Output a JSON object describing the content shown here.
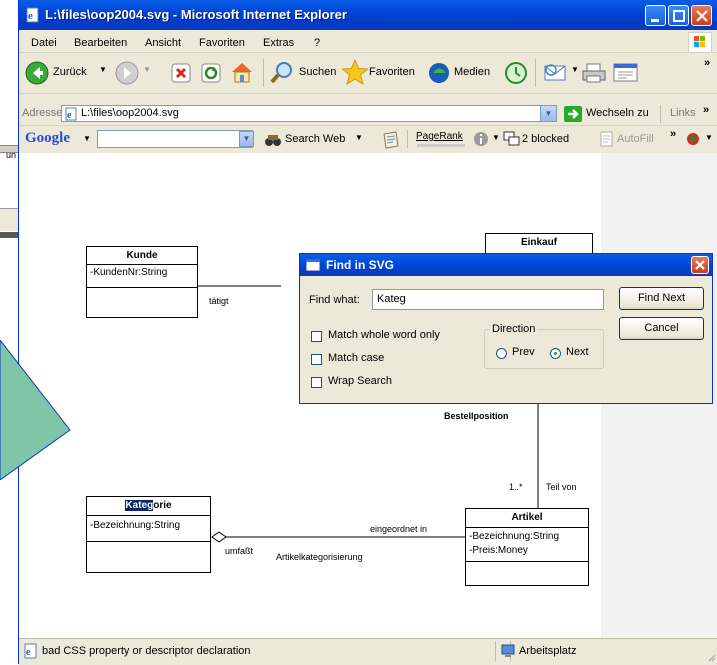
{
  "window": {
    "title": "L:\\files\\oop2004.svg - Microsoft Internet Explorer"
  },
  "background_fragment": "un",
  "menu": [
    "Datei",
    "Bearbeiten",
    "Ansicht",
    "Favoriten",
    "Extras",
    "?"
  ],
  "toolbar": {
    "back_label": "Zurück",
    "search_label": "Suchen",
    "favorites_label": "Favoriten",
    "media_label": "Medien",
    "overflow": "»"
  },
  "address": {
    "label": "Adresse",
    "value": "L:\\files\\oop2004.svg",
    "go_label": "Wechseln zu",
    "links_label": "Links",
    "overflow": "»"
  },
  "google": {
    "brand": "Google",
    "search_web_label": "Search Web",
    "pagerank_label": "PageRank",
    "blocked_label": "2 blocked",
    "autofill_label": "AutoFill",
    "overflow": "»"
  },
  "uml": {
    "kunde": {
      "name": "Kunde",
      "attrs": [
        "-KundenNr:String"
      ]
    },
    "einkauf": {
      "name": "Einkauf"
    },
    "kategorie": {
      "name_highlight": "Kateg",
      "name_rest": "orie",
      "attrs": [
        "-Bezeichnung:String"
      ]
    },
    "artikel": {
      "name": "Artikel",
      "attrs": [
        "-Bezeichnung:String",
        "-Preis:Money"
      ]
    },
    "labels": {
      "taetigt": "tätigt",
      "bestellposition": "Bestellposition",
      "multiplicity": "1..*",
      "teil_von": "Teil von",
      "eingeordnet_in": "eingeordnet in",
      "umfasst": "umfaßt",
      "artikelkategorisierung": "Artikelkategorisierung"
    }
  },
  "dialog": {
    "title": "Find in SVG",
    "find_label": "Find what:",
    "find_value": "Kateg",
    "find_next_label": "Find Next",
    "cancel_label": "Cancel",
    "match_whole_word_label": "Match whole word only",
    "match_case_label": "Match case",
    "wrap_search_label": "Wrap Search",
    "direction_label": "Direction",
    "prev_label": "Prev",
    "next_label": "Next",
    "direction_selected": "Next"
  },
  "status": {
    "message": "bad CSS property or descriptor declaration",
    "zone": "Arbeitsplatz"
  },
  "colors": {
    "titlebar": "#0a5ee8",
    "window_face": "#ece9d8",
    "highlight": "#0a246a",
    "arrow_fill": "#7fc5a8"
  }
}
